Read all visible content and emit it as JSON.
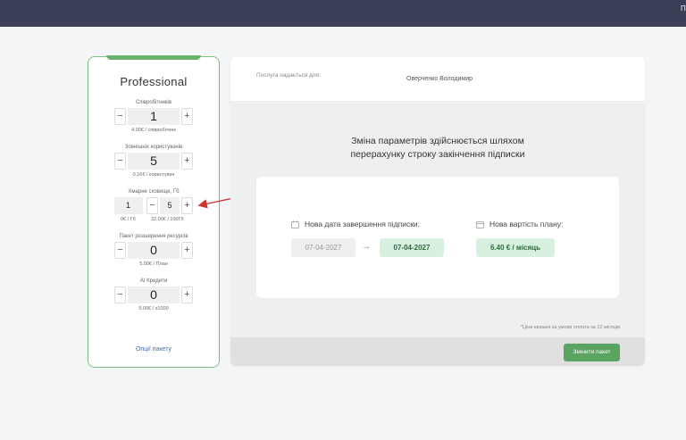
{
  "topbar": {
    "corner_text": "П"
  },
  "plan": {
    "title": "Professional",
    "employees": {
      "label": "Співробітників",
      "value": "1",
      "price": "4.00€ / співробітник"
    },
    "external_users": {
      "label": "Зовнішніх користувачів",
      "value": "5",
      "price": "0.16€ / користувач"
    },
    "cloud": {
      "label": "Хмарне сховище, Гб",
      "value_base": "1",
      "value_extra": "5",
      "price_base": "0€ / Гб",
      "price_extra": "32.00€ / 100Гб"
    },
    "resources": {
      "label": "Пакет розширення ресурсів",
      "value": "0",
      "price": "5.00€ / План"
    },
    "ai": {
      "label": "AI Кредити",
      "value": "0",
      "price": "5.00€ / x1000"
    },
    "options_link": "Опції пакету",
    "minus": "−",
    "plus": "+"
  },
  "main": {
    "provided_for_label": "Послуга надається для:",
    "provided_for_value": "Оверченко Володимир",
    "message_line1": "Зміна параметрів здійснюється шляхом",
    "message_line2": "перерахунку строку закінчення підписки",
    "new_date_label": "Нова дата завершення підписки:",
    "new_price_label": "Нова вартість плану:",
    "old_date": "07-04-2027",
    "new_date": "07-04-2027",
    "arrow": "→",
    "new_price": "6.40 € / місяць",
    "note": "*Ціни вказані за умови оплати за 12 місяців",
    "change_button": "Змінити пакет"
  },
  "icons": {
    "calendar": "calendar-icon",
    "wallet": "wallet-icon"
  }
}
